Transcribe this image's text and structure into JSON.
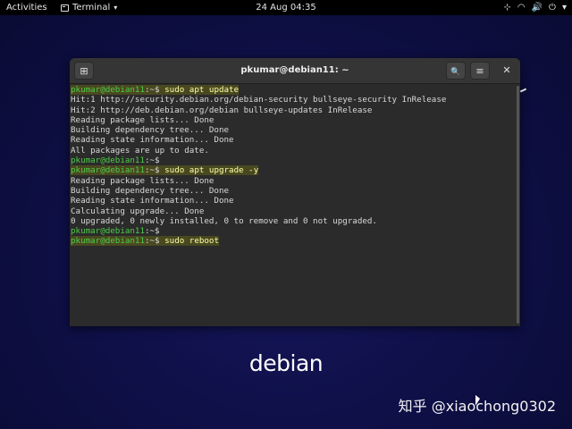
{
  "topbar": {
    "activities": "Activities",
    "app_name": "Terminal",
    "caret": "▾",
    "clock": "24 Aug  04:35",
    "tray": {
      "network_icon": "⊹",
      "wifi_icon": "◠",
      "volume_icon": "🔊",
      "power_icon": "⏻",
      "menu_caret": "▾"
    }
  },
  "window": {
    "title": "pkumar@debian11: ~",
    "new_tab_icon": "⊞",
    "search_icon": "🔍",
    "menu_icon": "≡",
    "close_icon": "✕"
  },
  "terminal": {
    "lines": [
      {
        "prompt": "pkumar@debian11",
        "sep": ":~$ ",
        "cmd": "sudo apt update",
        "hl": true
      },
      {
        "text": "Hit:1 http://security.debian.org/debian-security bullseye-security InRelease"
      },
      {
        "text": "Hit:2 http://deb.debian.org/debian bullseye-updates InRelease"
      },
      {
        "text": "Reading package lists... Done"
      },
      {
        "text": "Building dependency tree... Done"
      },
      {
        "text": "Reading state information... Done"
      },
      {
        "text": "All packages are up to date."
      },
      {
        "prompt": "pkumar@debian11",
        "sep": ":~$ ",
        "cmd": "",
        "hl": false
      },
      {
        "prompt": "pkumar@debian11",
        "sep": ":~$ ",
        "cmd": "sudo apt upgrade -y",
        "hl": true
      },
      {
        "text": "Reading package lists... Done"
      },
      {
        "text": "Building dependency tree... Done"
      },
      {
        "text": "Reading state information... Done"
      },
      {
        "text": "Calculating upgrade... Done"
      },
      {
        "text": "0 upgraded, 0 newly installed, 0 to remove and 0 not upgraded."
      },
      {
        "prompt": "pkumar@debian11",
        "sep": ":~$ ",
        "cmd": "",
        "hl": false
      },
      {
        "prompt": "pkumar@debian11",
        "sep": ":~$ ",
        "cmd": "sudo reboot",
        "hl": true
      }
    ]
  },
  "desktop": {
    "logo_text_a": "deb",
    "logo_text_b": "ian",
    "watermark": "知乎 @xiaochong0302"
  },
  "colors": {
    "prompt": "#4ecb49",
    "command": "#ffffa8",
    "debian_dot": "#d70a53"
  }
}
